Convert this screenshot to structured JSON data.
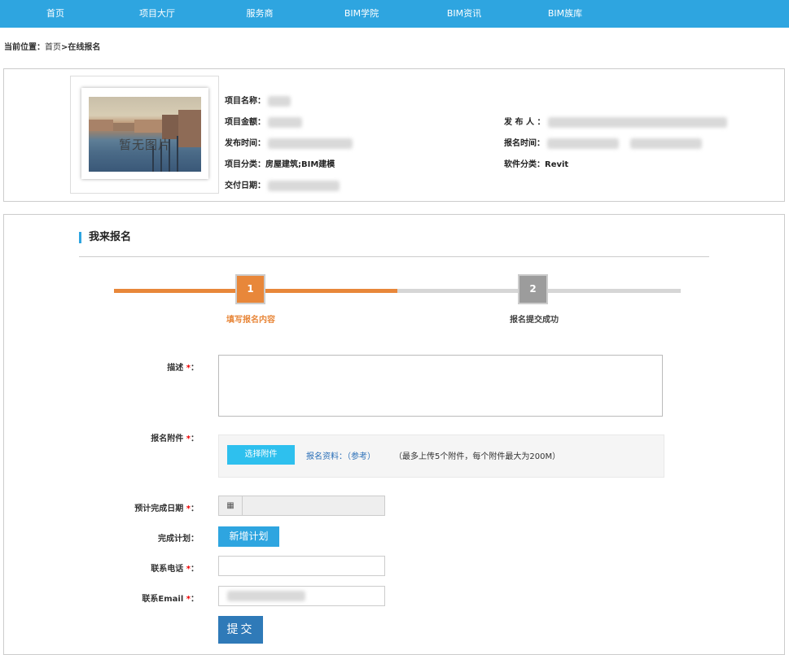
{
  "nav": {
    "items": [
      {
        "label": "首页"
      },
      {
        "label": "项目大厅"
      },
      {
        "label": "服务商"
      },
      {
        "label": "BIM学院"
      },
      {
        "label": "BIM资讯"
      },
      {
        "label": "BIM族库"
      }
    ]
  },
  "breadcrumb": {
    "prefix": "当前位置：",
    "home": "首页",
    "separator": ">",
    "current": "在线报名"
  },
  "project": {
    "thumbnail_text": "暂无图片",
    "fields": {
      "name_label": "项目名称：",
      "amount_label": "项目金额：",
      "publish_time_label": "发布时间：",
      "category_label": "项目分类：",
      "category_value": "房屋建筑;BIM建模",
      "delivery_label": "交付日期：",
      "publisher_label": "发 布 人 ：",
      "signup_time_label": "报名时间：",
      "software_label": "软件分类：",
      "software_value": "Revit"
    }
  },
  "signup": {
    "title": "我来报名",
    "steps": [
      {
        "num": "1",
        "label": "填写报名内容",
        "state": "active"
      },
      {
        "num": "2",
        "label": "报名提交成功",
        "state": "inactive"
      }
    ],
    "form": {
      "description_label": "描述",
      "attachment_label": "报名附件",
      "choose_attachment": "选择附件",
      "reference_link": "报名资料：（参考）",
      "attachment_note": "（最多上传5个附件，每个附件最大为200M）",
      "due_date_label": "预计完成日期",
      "plan_label": "完成计划",
      "add_plan": "新增计划",
      "phone_label": "联系电话",
      "email_label": "联系Email",
      "required_mark": "*",
      "colon": "：",
      "submit": "提交"
    }
  },
  "colors": {
    "nav": "#2ea5e0",
    "step_active": "#e8873a",
    "step_inactive": "#9c9c9c",
    "track_inactive": "#d6d6d6",
    "required": "#ee0000",
    "submit": "#2f7ab8",
    "choose_button": "#2ec0ee"
  },
  "icons": {
    "calendar": "calendar-icon"
  }
}
